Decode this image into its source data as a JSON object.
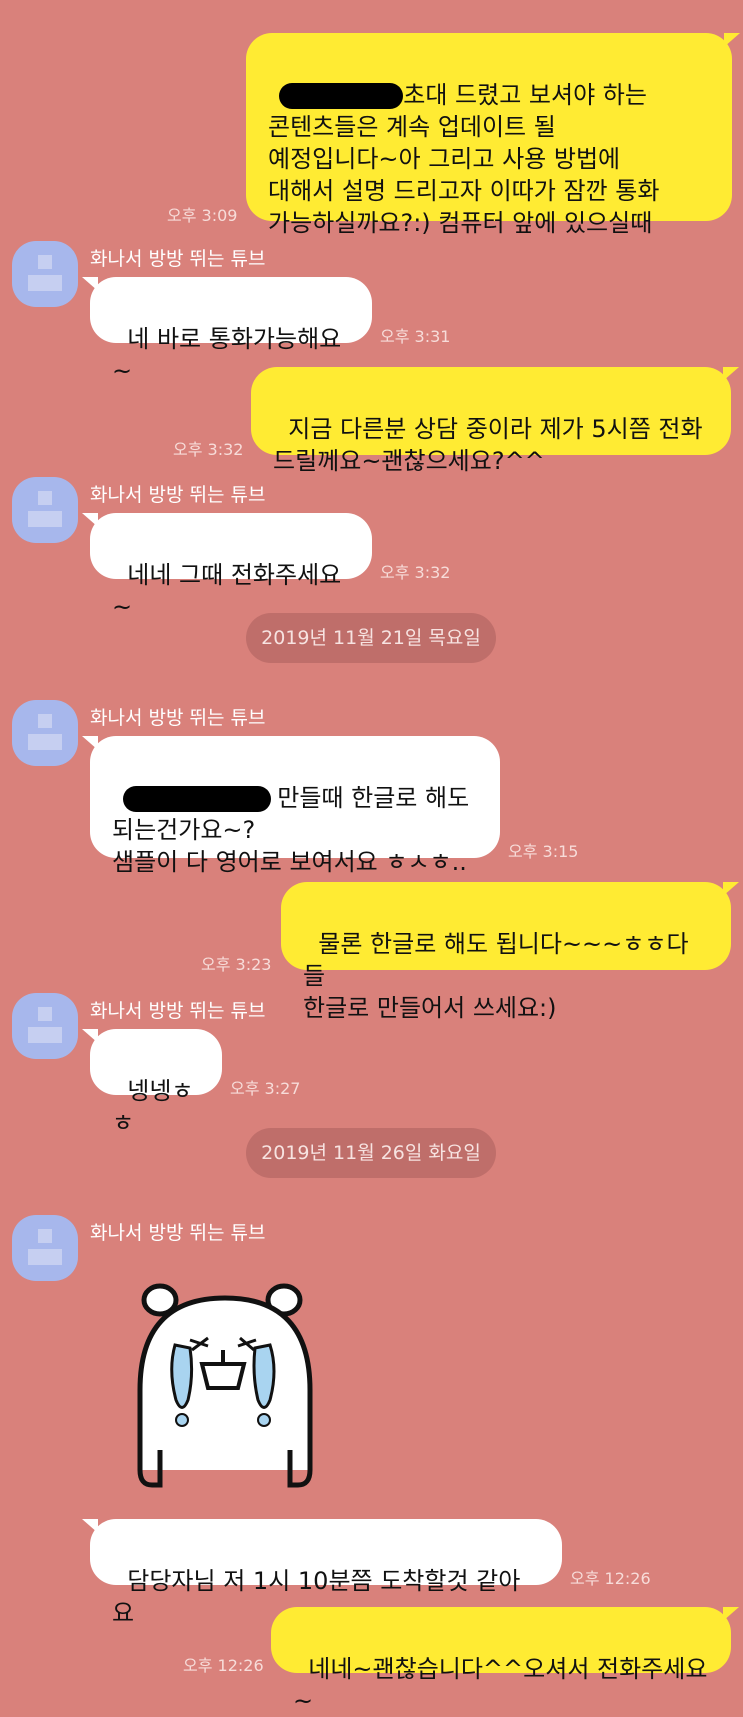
{
  "sender_name": "화나서 방방 뛰는 튜브",
  "messages": [
    {
      "from": "me",
      "text": "초대 드렸고 보셔야 하는\n콘텐츠들은 계속 업데이트 될\n예정입니다~아 그리고 사용 방법에\n대해서 설명 드리고자 이따가 잠깐 통화\n가능하실까요?:) 컴퓨터 앞에 있으실때",
      "time": "오후 3:09"
    },
    {
      "from": "them",
      "text": "네 바로 통화가능해요~",
      "time": "오후 3:31"
    },
    {
      "from": "me",
      "text": "지금 다른분 상담 중이라 제가 5시쯤 전화\n드릴께요~괜찮으세요?^^",
      "time": "오후 3:32"
    },
    {
      "from": "them",
      "text": "네네 그때 전화주세요~",
      "time": "오후 3:32"
    },
    {
      "from": "them",
      "text": "만들때 한글로 해도\n되는건가요~?\n샘플이 다 영어로 보여서요 ㅎㅅㅎ..",
      "time": "오후 3:15"
    },
    {
      "from": "me",
      "text": "물론 한글로 해도 됩니다~~~ㅎㅎ다들\n한글로 만들어서 쓰세요:)",
      "time": "오후 3:23"
    },
    {
      "from": "them",
      "text": "넹넹ㅎㅎ",
      "time": "오후 3:27"
    },
    {
      "from": "them",
      "text": "담당자님 저 1시 10분쯤 도착할것 같아요",
      "time": "오후 12:26"
    },
    {
      "from": "me",
      "text": "네네~괜찮습니다^^오셔서 전화주세요~",
      "time": "오후 12:26"
    }
  ],
  "dates": [
    "2019년 11월 21일 목요일",
    "2019년 11월 26일 화요일"
  ],
  "sticker": {
    "icon": "crying-bear-sticker-icon"
  },
  "colors": {
    "background": "#d9817b",
    "my_bubble": "#ffeb33",
    "their_bubble": "#ffffff",
    "avatar": "#a7b7ec"
  }
}
